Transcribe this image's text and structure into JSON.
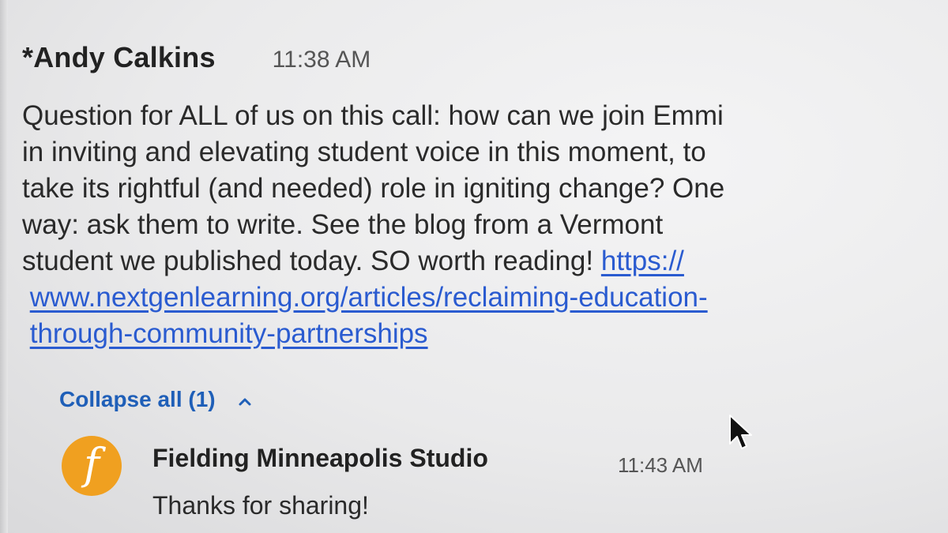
{
  "message": {
    "sender": "*Andy Calkins",
    "time": "11:38 AM",
    "lines": [
      "Question for ALL of us on this call: how can we join Emmi",
      "in inviting and elevating student voice in this moment, to",
      "take its rightful (and needed) role in igniting change? One",
      "way: ask them to write. See the blog from a Vermont",
      "student we published today. SO worth reading!  "
    ],
    "link_lines": [
      "https://",
      "www.nextgenlearning.org/articles/reclaiming-education-",
      "through-community-partnerships"
    ]
  },
  "thread": {
    "collapse_label": "Collapse all (1)",
    "chevron_icon": "chevron-up-icon"
  },
  "reply": {
    "avatar_letter": "f",
    "avatar_color": "#f0a020",
    "sender": "Fielding Minneapolis Studio",
    "time": "11:43 AM",
    "text": "Thanks for sharing!"
  },
  "colors": {
    "link": "#2a5bd0",
    "collapse": "#1f5fb8"
  }
}
